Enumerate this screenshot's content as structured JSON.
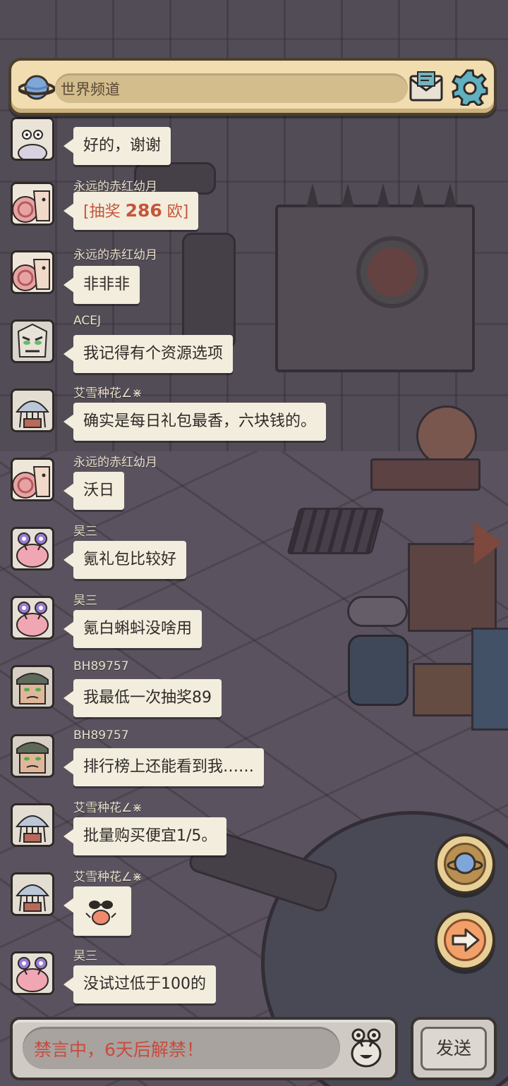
{
  "header": {
    "channel_label": "世界频道",
    "planet_icon": "planet-icon",
    "mail_icon": "mail-icon",
    "settings_icon": "gear-icon"
  },
  "messages": [
    {
      "user": "",
      "text": "好的，谢谢",
      "avatar": "snail-white"
    },
    {
      "user": "永远的赤红幼月",
      "text_prefix": "[抽奖 ",
      "text_number": "286",
      "text_suffix": " 欧]",
      "avatar": "snail-pink",
      "lottery": true
    },
    {
      "user": "永远的赤红幼月",
      "text": "非非非",
      "avatar": "snail-pink"
    },
    {
      "user": "ACEJ",
      "text": "我记得有个资源选项",
      "avatar": "face-green-eyes"
    },
    {
      "user": "艾雪种花∠⋇",
      "text": "确实是每日礼包最香，六块钱的。",
      "avatar": "jellyfish"
    },
    {
      "user": "永远的赤红幼月",
      "text": "沃日",
      "avatar": "snail-pink"
    },
    {
      "user": "昊三",
      "text": "氪礼包比较好",
      "avatar": "pink-alien"
    },
    {
      "user": "昊三",
      "text": "氪白蝌蚪没啥用",
      "avatar": "pink-alien"
    },
    {
      "user": "BH89757",
      "text": "我最低一次抽奖89",
      "avatar": "soldier"
    },
    {
      "user": "BH89757",
      "text": "排行榜上还能看到我……",
      "avatar": "soldier"
    },
    {
      "user": "艾雪种花∠⋇",
      "text": "批量购买便宜1/5。",
      "avatar": "jellyfish"
    },
    {
      "user": "艾雪种花∠⋇",
      "text": "",
      "emote": "sunglasses-crab",
      "avatar": "jellyfish"
    },
    {
      "user": "昊三",
      "text": "没试过低于100的",
      "avatar": "pink-alien"
    }
  ],
  "side_buttons": {
    "world_icon": "planet-icon",
    "next_icon": "arrow-right-icon"
  },
  "bottom": {
    "input_text": "禁言中，6天后解禁！",
    "emoji_icon": "alien-face-icon",
    "send_label": "发送"
  },
  "colors": {
    "header_bg": "#f1ddb0",
    "bubble_bg": "#f2eddd",
    "muted_text": "#c94b3e",
    "lottery_text": "#c6553a"
  }
}
